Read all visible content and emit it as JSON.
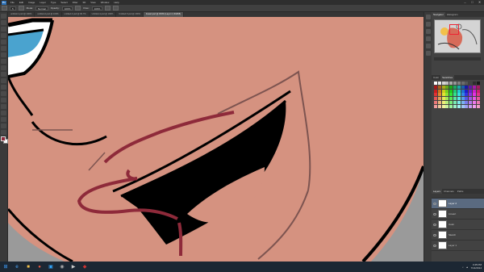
{
  "app": {
    "logo": "Ps"
  },
  "menu": [
    "File",
    "Edit",
    "Image",
    "Layer",
    "Type",
    "Select",
    "Filter",
    "3D",
    "View",
    "Window",
    "Help"
  ],
  "window_controls": {
    "minimize": "–",
    "maximize": "□",
    "close": "✕"
  },
  "options": {
    "size": "5",
    "mode_label": "Mode:",
    "mode": "Normal",
    "opacity_label": "Opacity:",
    "opacity": "100%",
    "flow_label": "Flow:",
    "flow": "100%"
  },
  "tabs": [
    "untitled-1.psd @ 100%",
    "untitled-2.psd @ 100%",
    "untitled-3.psd @ 66.7%",
    "Untitled-4.psd @ 100%",
    "Untitled-5.psd @ 200%",
    "lineart.psd @ 300% (Layer 2, RGB/8)"
  ],
  "panels": {
    "navigator_tabs": [
      "Navigator",
      "Histogram"
    ],
    "swatches_tabs": [
      "Color",
      "Swatches"
    ],
    "layers_tabs": [
      "Layers",
      "Channels",
      "Paths"
    ]
  },
  "layers": [
    "Layer 2",
    "Lineart",
    "Color",
    "Sketch",
    "Layer 1"
  ],
  "colors": {
    "canvas_skin": "#d59280",
    "lip_red": "#8e2a3a",
    "outline": "#000000",
    "eye_blue": "#4aa3cf",
    "gray_fill": "#9a9a9a"
  },
  "taskbar": {
    "time": "3:45 PM",
    "date": "7/14/2014"
  }
}
